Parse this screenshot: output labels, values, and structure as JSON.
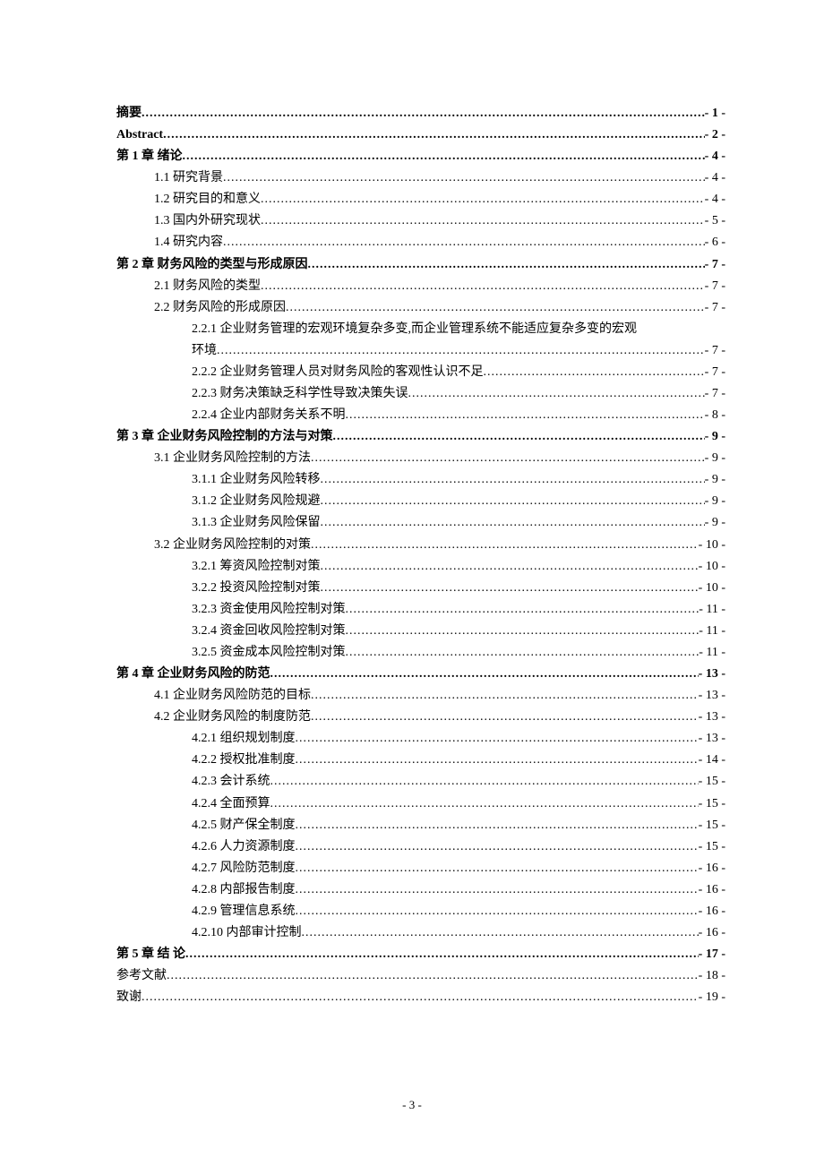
{
  "toc": [
    {
      "level": 0,
      "label": "摘要",
      "page": "- 1 -"
    },
    {
      "level": 0,
      "label": "Abstract",
      "page": "- 2 -"
    },
    {
      "level": 0,
      "label": "第 1 章  绪论",
      "page": "- 4 -"
    },
    {
      "level": 1,
      "label": "1.1  研究背景",
      "page": "- 4 -"
    },
    {
      "level": 1,
      "label": "1.2  研究目的和意义",
      "page": "- 4 -"
    },
    {
      "level": 1,
      "label": "1.3  国内外研究现状",
      "page": "- 5 -"
    },
    {
      "level": 1,
      "label": "1.4 研究内容",
      "page": "- 6 -"
    },
    {
      "level": 0,
      "label": "第 2 章  财务风险的类型与形成原因",
      "page": "- 7 -"
    },
    {
      "level": 1,
      "label": "2.1  财务风险的类型",
      "page": "- 7 -"
    },
    {
      "level": 1,
      "label": "2.2  财务风险的形成原因",
      "page": "- 7 -"
    },
    {
      "level": 2,
      "wrap": true,
      "label1": "2.2.1  企业财务管理的宏观环境复杂多变,而企业管理系统不能适应复杂多变的宏观",
      "label2": "环境",
      "page": "- 7 -"
    },
    {
      "level": 2,
      "label": "2.2.2  企业财务管理人员对财务风险的客观性认识不足",
      "page": "- 7 -"
    },
    {
      "level": 2,
      "label": "2.2.3  财务决策缺乏科学性导致决策失误",
      "page": "- 7 -"
    },
    {
      "level": 2,
      "label": "2.2.4  企业内部财务关系不明",
      "page": "- 8 -"
    },
    {
      "level": 0,
      "label": "第 3 章  企业财务风险控制的方法与对策",
      "page": "- 9 -"
    },
    {
      "level": 1,
      "label": "3.1  企业财务风险控制的方法",
      "page": "- 9 -"
    },
    {
      "level": 2,
      "label": "3.1.1 企业财务风险转移",
      "page": "- 9 -"
    },
    {
      "level": 2,
      "label": "3.1.2 企业财务风险规避",
      "page": "- 9 -"
    },
    {
      "level": 2,
      "label": "3.1.3 企业财务风险保留",
      "page": "- 9 -"
    },
    {
      "level": 1,
      "label": "3.2  企业财务风险控制的对策",
      "page": "- 10 -"
    },
    {
      "level": 2,
      "label": "3.2.1  筹资风险控制对策",
      "page": "- 10 -"
    },
    {
      "level": 2,
      "label": "3.2.2  投资风险控制对策",
      "page": "- 10 -"
    },
    {
      "level": 2,
      "label": "3.2.3  资金使用风险控制对策",
      "page": "- 11 -"
    },
    {
      "level": 2,
      "label": "3.2.4  资金回收风险控制对策",
      "page": "- 11 -"
    },
    {
      "level": 2,
      "label": "3.2.5  资金成本风险控制对策",
      "page": "- 11 -"
    },
    {
      "level": 0,
      "label": "第 4 章  企业财务风险的防范",
      "page": "- 13 -"
    },
    {
      "level": 1,
      "label": "4.1 企业财务风险防范的目标",
      "page": "- 13 -"
    },
    {
      "level": 1,
      "label": "4.2  企业财务风险的制度防范",
      "page": "- 13 -"
    },
    {
      "level": 2,
      "label": "4.2.1 组织规划制度",
      "page": "- 13 -"
    },
    {
      "level": 2,
      "label": "4.2.2 授权批准制度",
      "page": "- 14 -"
    },
    {
      "level": 2,
      "label": "4.2.3 会计系统",
      "page": "- 15 -"
    },
    {
      "level": 2,
      "label": "4.2.4 全面预算",
      "page": "- 15 -"
    },
    {
      "level": 2,
      "label": "4.2.5 财产保全制度",
      "page": "- 15 -"
    },
    {
      "level": 2,
      "label": "4.2.6 人力资源制度",
      "page": "- 15 -"
    },
    {
      "level": 2,
      "label": "4.2.7 风险防范制度",
      "page": "- 16 -"
    },
    {
      "level": 2,
      "label": "4.2.8 内部报告制度",
      "page": "- 16 -"
    },
    {
      "level": 2,
      "label": "4.2.9 管理信息系统",
      "page": "- 16 -"
    },
    {
      "level": 2,
      "label": "4.2.10 内部审计控制",
      "page": "- 16 -"
    },
    {
      "level": 0,
      "label": "第 5 章  结 论",
      "page": "- 17 -"
    },
    {
      "level": 0,
      "label": "参考文献",
      "page": "- 18 -",
      "normal": true
    },
    {
      "level": 0,
      "label": "致谢",
      "page": "- 19 -",
      "normal": true
    }
  ],
  "footer": "- 3 -"
}
